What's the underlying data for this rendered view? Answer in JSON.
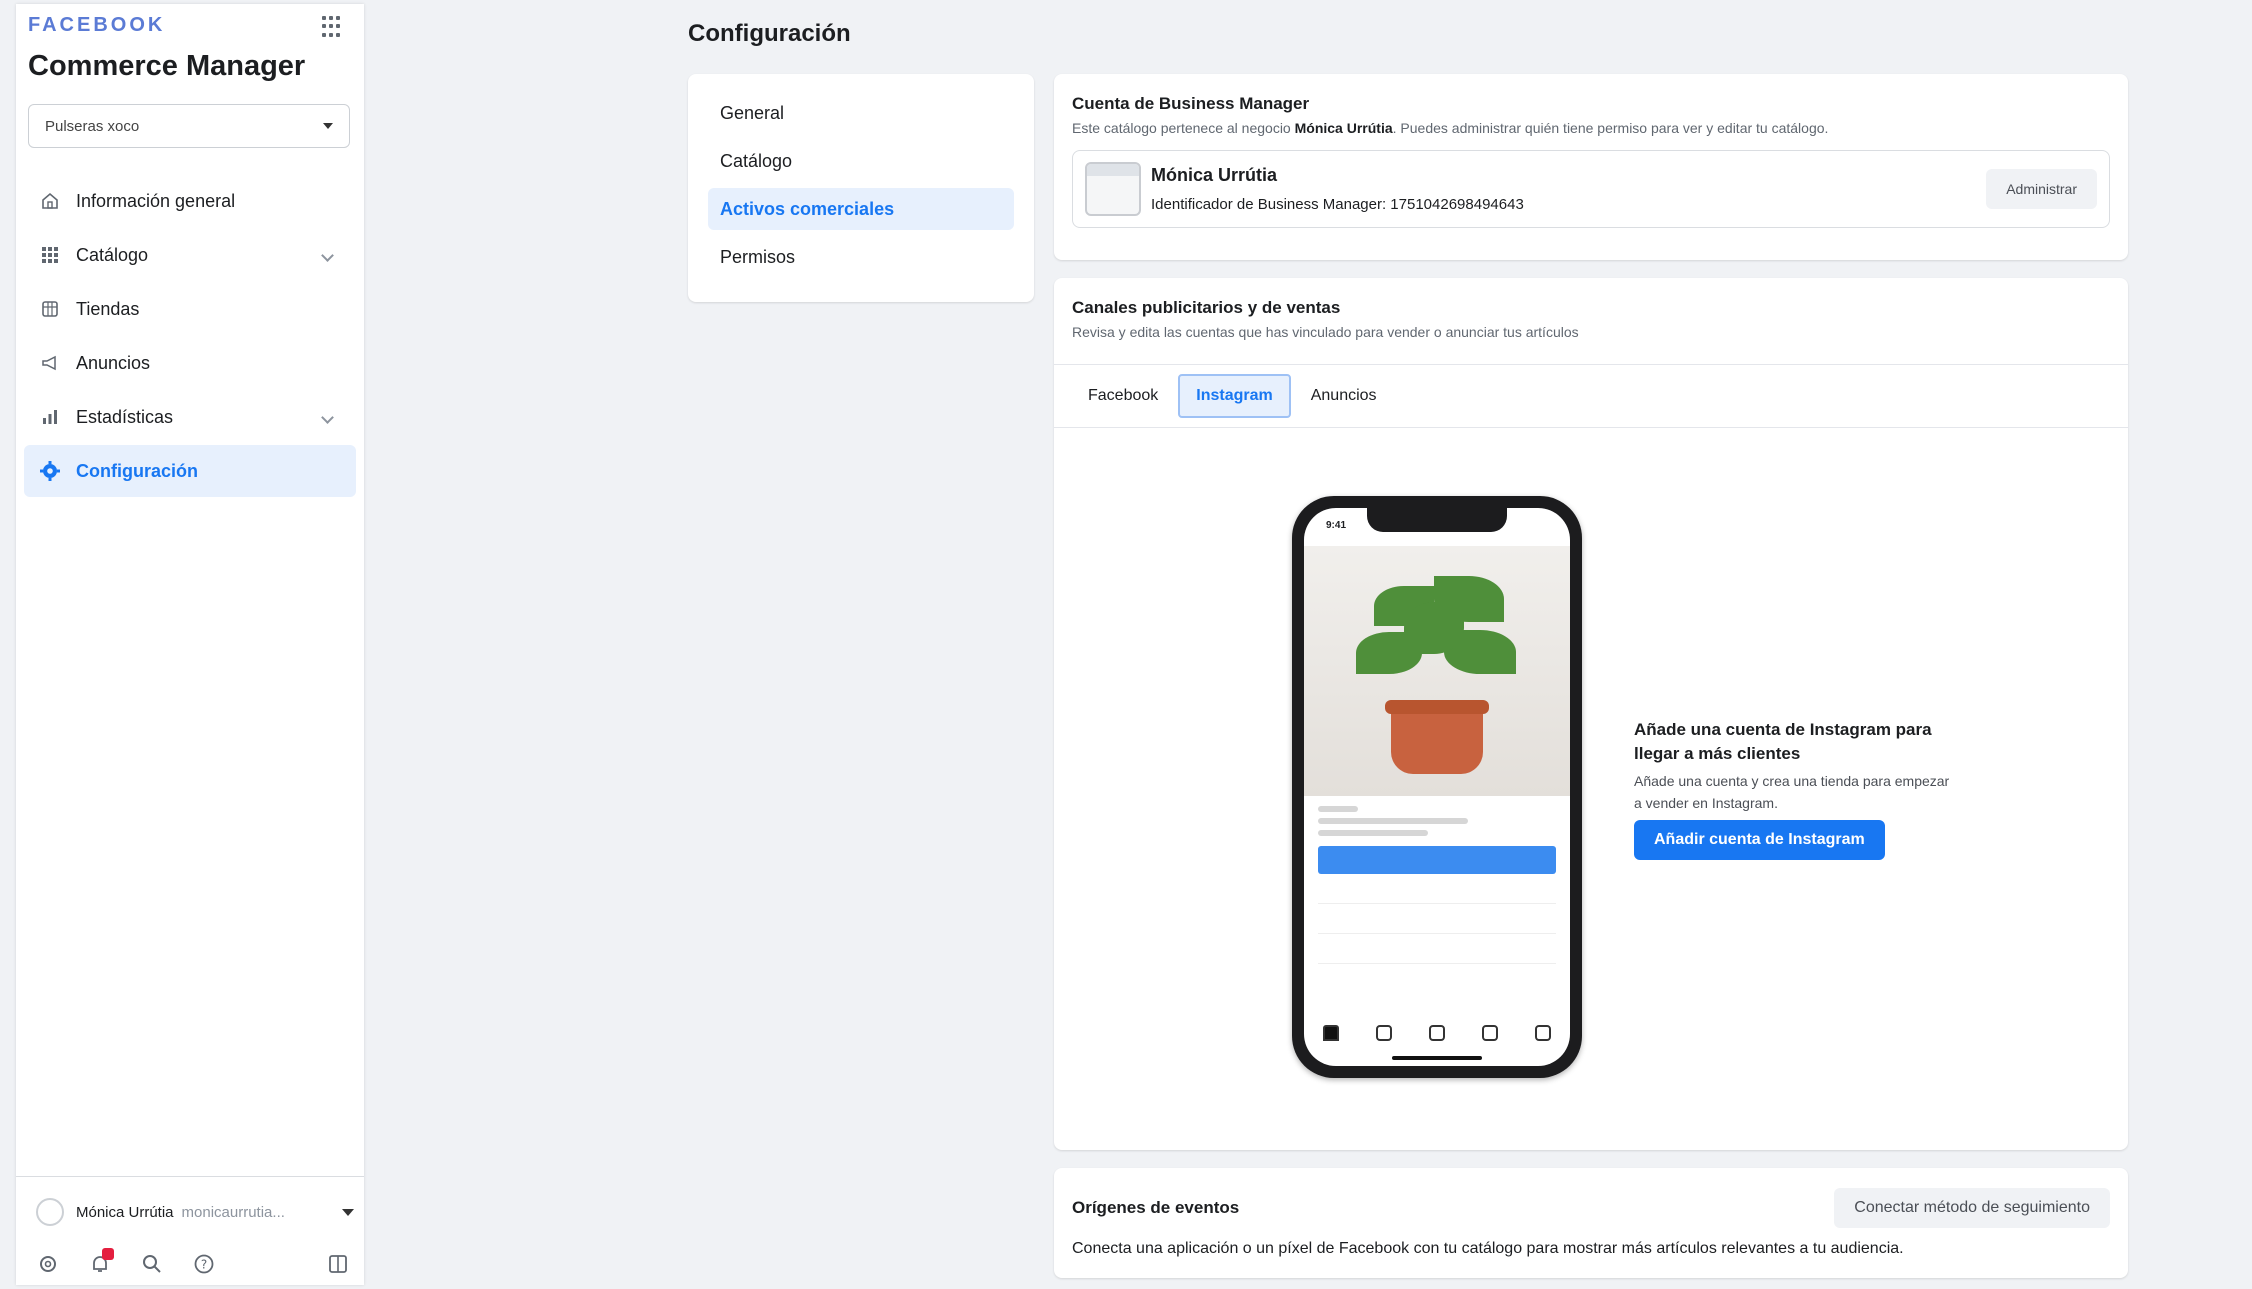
{
  "sidebar": {
    "brand": "FACEBOOK",
    "app_title": "Commerce Manager",
    "catalog_select": "Pulseras xoco",
    "items": [
      {
        "label": "Información general"
      },
      {
        "label": "Catálogo"
      },
      {
        "label": "Tiendas"
      },
      {
        "label": "Anuncios"
      },
      {
        "label": "Estadísticas"
      },
      {
        "label": "Configuración"
      }
    ],
    "user": {
      "name": "Mónica Urrútia",
      "handle": "monicaurrutia..."
    }
  },
  "main": {
    "page_title": "Configuración",
    "subnav": [
      "General",
      "Catálogo",
      "Activos comerciales",
      "Permisos"
    ],
    "bm_card": {
      "title": "Cuenta de Business Manager",
      "sub_prefix": "Este catálogo pertenece al negocio ",
      "sub_bold": "Mónica Urrútia",
      "sub_suffix": ". Puedes administrar quién tiene permiso para ver y editar tu catálogo.",
      "name": "Mónica Urrútia",
      "id_line": "Identificador de Business Manager: 1751042698494643",
      "admin_button": "Administrar"
    },
    "channels_card": {
      "title": "Canales publicitarios y de ventas",
      "sub": "Revisa y edita las cuentas que has vinculado para vender o anunciar tus artículos",
      "tabs": [
        "Facebook",
        "Instagram",
        "Anuncios"
      ],
      "phone_time": "9:41",
      "promo_title": "Añade una cuenta de Instagram para llegar a más clientes",
      "promo_text": "Añade una cuenta y crea una tienda para empezar a vender en Instagram.",
      "promo_button": "Añadir cuenta de Instagram"
    },
    "events_card": {
      "title": "Orígenes de eventos",
      "button": "Conectar método de seguimiento",
      "desc": "Conecta una aplicación o un píxel de Facebook con tu catálogo para mostrar más artículos relevantes a tu audiencia."
    }
  },
  "colors": {
    "accent": "#1877f2",
    "active_bg": "#e7f0fd",
    "background": "#f0f2f5"
  }
}
